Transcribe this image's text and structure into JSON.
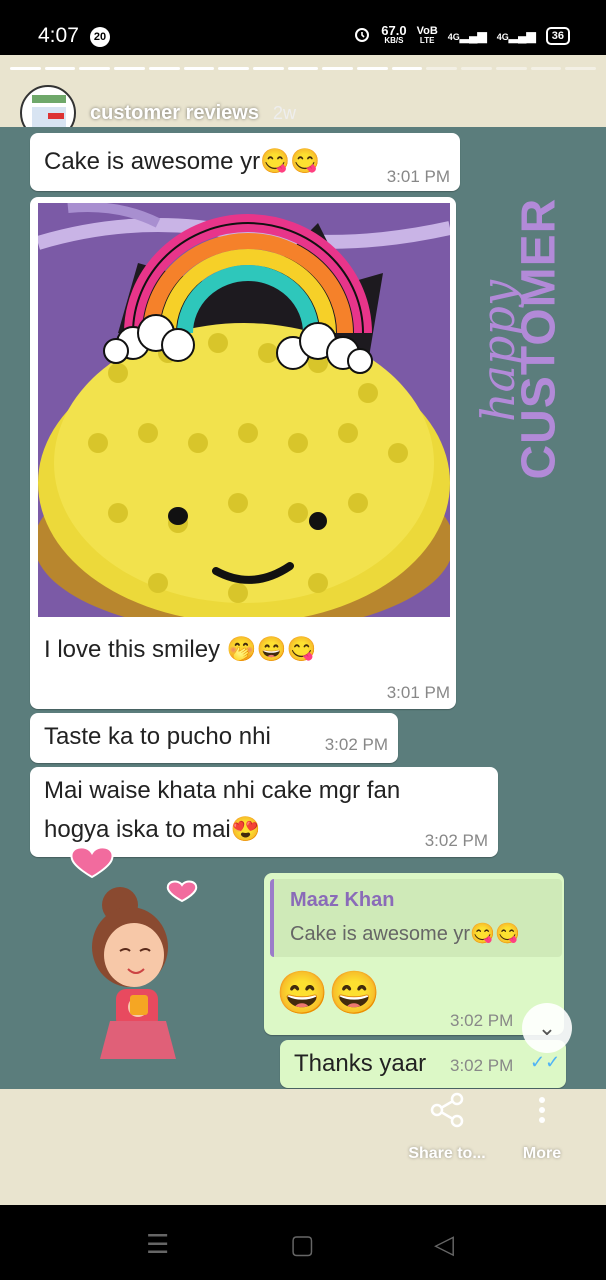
{
  "status": {
    "time": "4:07",
    "notification_count": "20",
    "net_speed_value": "67.0",
    "net_speed_unit": "KB/S",
    "volte_top": "VoB",
    "volte_bottom": "LTE",
    "signal1": "4G",
    "signal2": "4G",
    "battery": "36"
  },
  "story": {
    "title": "customer reviews",
    "age": "2w",
    "segments_total": 17,
    "segments_done": 12
  },
  "chat": {
    "messages": [
      {
        "text": "Cake is awesome yr😋😋",
        "time": "3:01 PM"
      },
      {
        "text": "I love this smiley 🤭😄😋",
        "time": "3:01 PM"
      },
      {
        "text": "Taste ka to pucho nhi",
        "time": "3:02 PM"
      },
      {
        "text_line1": "Mai waise khata nhi cake mgr fan",
        "text_line2": "hogya iska to mai😍",
        "time": "3:02 PM"
      }
    ],
    "reply": {
      "quoted_author": "Maaz Khan",
      "quoted_text": "Cake is awesome yr😋😋",
      "emojis": "😄😄",
      "time": "3:02 PM"
    },
    "last": {
      "text": "Thanks yaar",
      "time": "3:02 PM",
      "ticks": "✓✓"
    },
    "sticker_text_small": "happy",
    "sticker_text_big": "CUSTOMER"
  },
  "footer": {
    "share_label": "Share to...",
    "more_label": "More"
  },
  "colors": {
    "chat_bg": "#5b7d7c",
    "outgoing_bubble": "#dcf8c6",
    "sticker_purple": "#b28ad8"
  }
}
